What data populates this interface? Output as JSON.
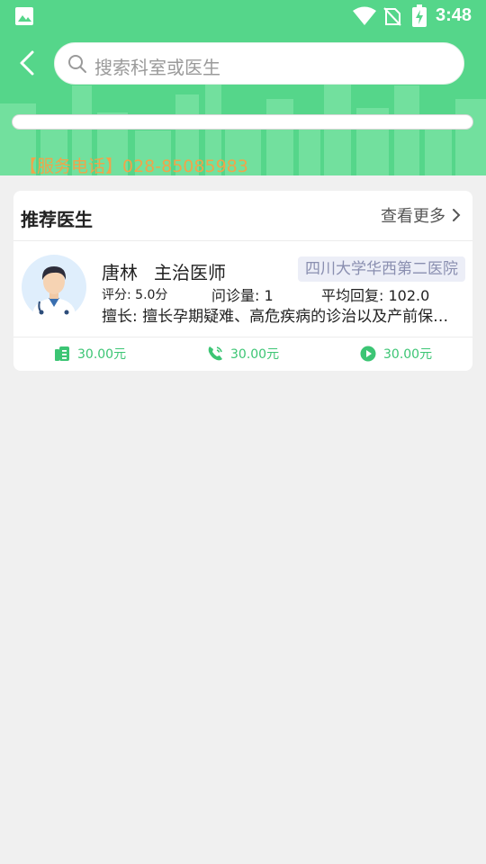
{
  "status_bar": {
    "time": "3:48"
  },
  "search": {
    "placeholder": "搜索科室或医生"
  },
  "service_phone": "【服务电话】028-85085983",
  "recommend": {
    "title": "推荐医生",
    "more_label": "查看更多"
  },
  "doctor": {
    "name": "唐林",
    "title": "主治医师",
    "hospital": "四川大学华西第二医院",
    "rating": "评分: 5.0分",
    "consults": "问诊量: 1",
    "avg_reply": "平均回复: 102.0",
    "specialty": "擅长: 擅长孕期疑难、高危疾病的诊治以及产前保健、产后康复等"
  },
  "prices": {
    "text_consult": "30.00元",
    "phone_consult": "30.00元",
    "video_consult": "30.00元"
  },
  "icons": {
    "back": "chevron-left-icon",
    "search": "search-icon",
    "more": "chevron-right-icon",
    "text": "document-icon",
    "phone": "phone-icon",
    "video": "play-icon"
  },
  "colors": {
    "header_green": "#55d68a",
    "accent_green": "#3cc574",
    "phone_orange": "#f0a44a",
    "badge_bg": "#eceef7"
  }
}
